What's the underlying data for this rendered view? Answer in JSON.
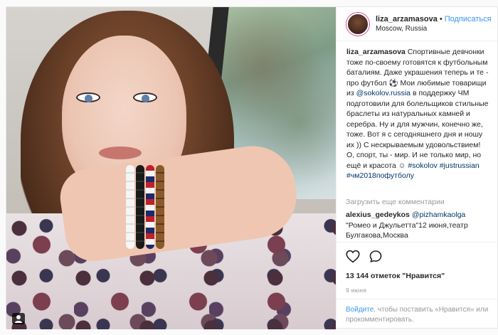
{
  "header": {
    "username": "liza_arzamasova",
    "separator": "•",
    "follow_label": "Подписаться",
    "location": "Moscow, Russia"
  },
  "caption": {
    "username": "liza_arzamasova",
    "text_1": "Спортивные девчонки тоже по-своему готовятся к футбольным баталиям. Даже украшения теперь и те - про футбол ⚽ Мои любимые товарищи из",
    "mention": "@sokolov.russia",
    "text_2": "в поддержку ЧМ подготовили для болельщиков стильные браслеты из натуральных камней и серебра. Ну и для мужчин, конечно же, тоже. Вот я с сегодняшнего дня и ношу их )) С нескрываемым удовольствием! О, спорт, ты - мир. И не только мир, но ещё и красота ☺",
    "hashtags": "#sokolov #justrussian #чм2018пофутболу"
  },
  "load_more": "Загрузить еще комментарии",
  "comment": {
    "username": "alexius_gedeykos",
    "mention": "@pizhamkaolga",
    "text": "\"Ромео и Джульетта\"12 июня,театр Булгакова,Москва"
  },
  "icons": {
    "heart": "heart-icon",
    "comment": "comment-icon",
    "account": "user-tag-icon"
  },
  "likes": "13 144 отметок \"Нравится\"",
  "date": "9 июня",
  "login": {
    "link": "Войдите",
    "text": ", чтобы поставить «Нравится» или прокомментировать."
  },
  "colors": {
    "link": "#3897f0",
    "hashtag": "#003569",
    "muted": "#999999"
  }
}
